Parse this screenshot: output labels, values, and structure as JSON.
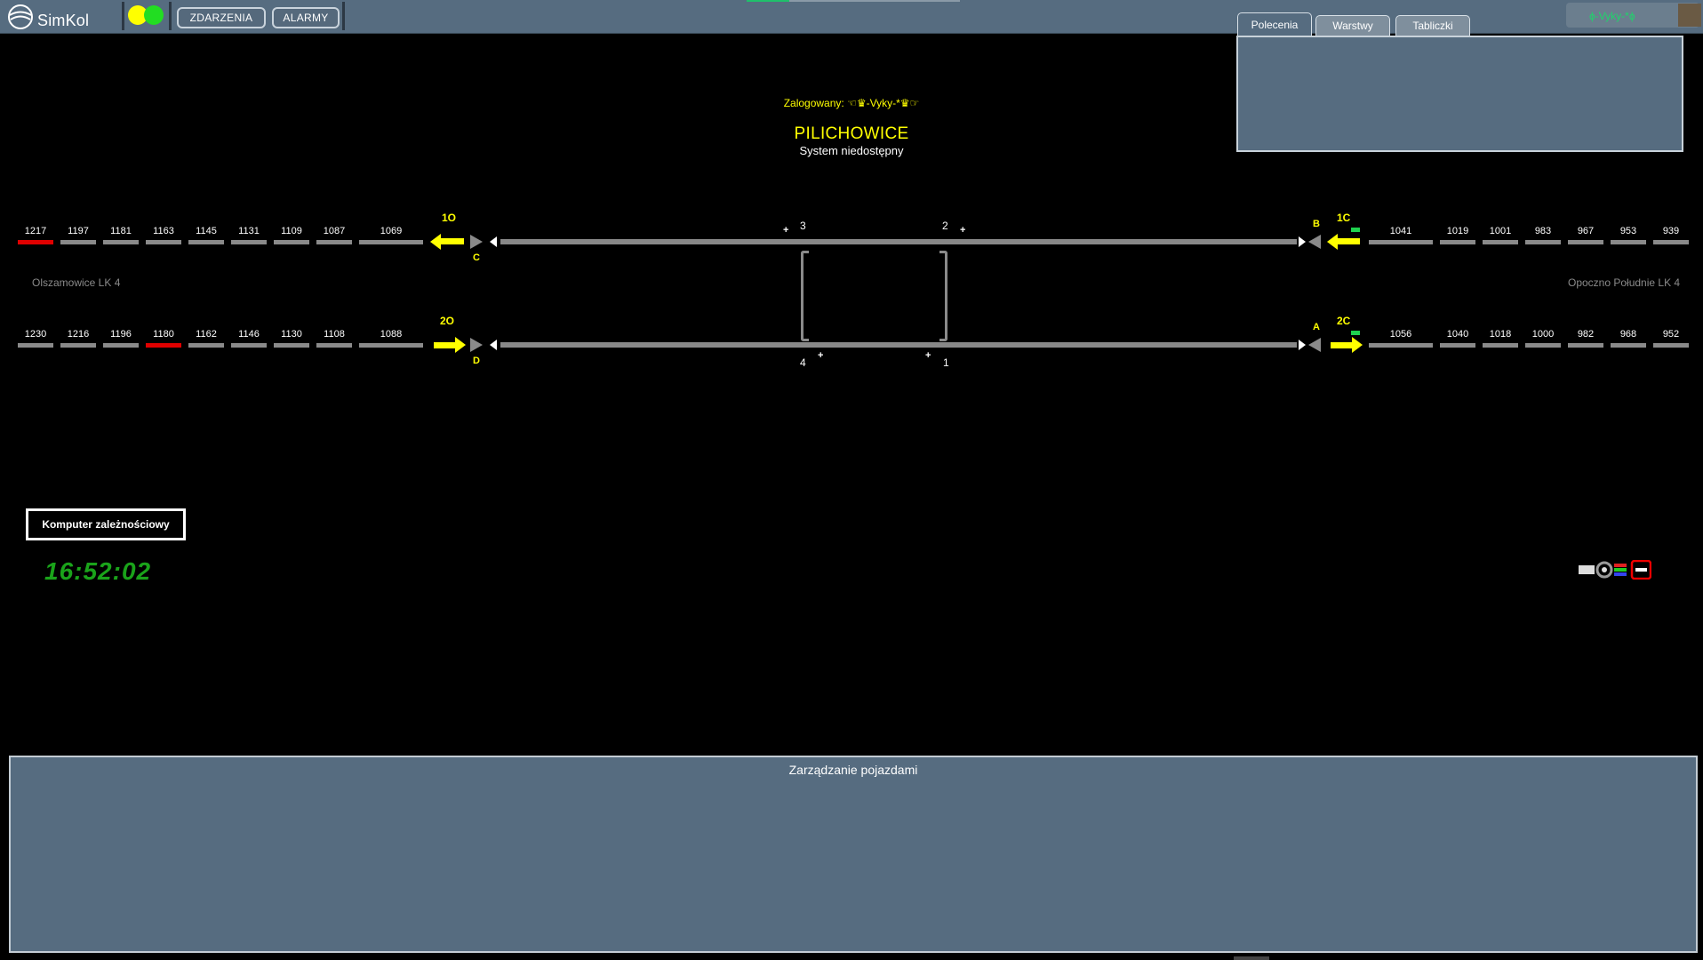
{
  "app": {
    "name": "SimKol"
  },
  "topbar": {
    "buttons": [
      {
        "label": "ZDARZENIA"
      },
      {
        "label": "ALARMY"
      }
    ],
    "lamps": {
      "left": "#ffff00",
      "right": "#22dd22"
    }
  },
  "tabs": [
    {
      "label": "Polecenia",
      "active": true
    },
    {
      "label": "Warstwy"
    },
    {
      "label": "Tabliczki"
    }
  ],
  "user": {
    "name": "ɸ-Vyky-*ɸ"
  },
  "center": {
    "logged_in": "Zalogowany: ☜♛-Vyky-*♛☞",
    "station": "PILICHOWICE",
    "status": "System niedostępny"
  },
  "stations": {
    "left": "Olszamowice LK 4",
    "right": "Opoczno Południe LK 4"
  },
  "track1": {
    "left_blocks": [
      {
        "label": "1217",
        "state": "occupied"
      },
      {
        "label": "1197",
        "state": "free"
      },
      {
        "label": "1181",
        "state": "free"
      },
      {
        "label": "1163",
        "state": "free"
      },
      {
        "label": "1145",
        "state": "free"
      },
      {
        "label": "1131",
        "state": "free"
      },
      {
        "label": "1109",
        "state": "free"
      },
      {
        "label": "1087",
        "state": "free"
      },
      {
        "label": "1069",
        "state": "free"
      }
    ],
    "right_blocks": [
      {
        "label": "1041"
      },
      {
        "label": "1019"
      },
      {
        "label": "1001"
      },
      {
        "label": "983"
      },
      {
        "label": "967"
      },
      {
        "label": "953"
      },
      {
        "label": "939"
      }
    ],
    "signals": {
      "left_exit": "1O",
      "left_entry": "C",
      "right_entry": "B",
      "right_exit": "1C"
    }
  },
  "track2": {
    "left_blocks": [
      {
        "label": "1230",
        "state": "free"
      },
      {
        "label": "1216",
        "state": "free"
      },
      {
        "label": "1196",
        "state": "free"
      },
      {
        "label": "1180",
        "state": "occupied"
      },
      {
        "label": "1162",
        "state": "free"
      },
      {
        "label": "1146",
        "state": "free"
      },
      {
        "label": "1130",
        "state": "free"
      },
      {
        "label": "1108",
        "state": "free"
      },
      {
        "label": "1088",
        "state": "free"
      }
    ],
    "right_blocks": [
      {
        "label": "1056"
      },
      {
        "label": "1040"
      },
      {
        "label": "1018"
      },
      {
        "label": "1000"
      },
      {
        "label": "982"
      },
      {
        "label": "968"
      },
      {
        "label": "952"
      }
    ],
    "signals": {
      "left_exit": "2O",
      "left_entry": "D",
      "right_entry": "A",
      "right_exit": "2C"
    }
  },
  "switches": {
    "s1": "1",
    "s2": "2",
    "s3": "3",
    "s4": "4",
    "plus": "+"
  },
  "control": {
    "computer_label": "Komputer zależnościowy",
    "clock": "16:52:02"
  },
  "vehicles_panel": {
    "title": "Zarządzanie pojazdami"
  },
  "colors": {
    "occupied": "#e00000",
    "free": "#8a8a8a",
    "signal": "#ffff00",
    "clock": "#1aa31a",
    "panel": "#566c80"
  }
}
